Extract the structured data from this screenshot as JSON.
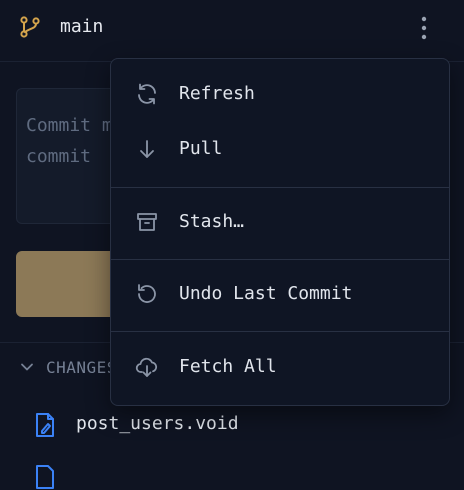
{
  "header": {
    "branch": "main"
  },
  "commit": {
    "placeholder": "Commit message\ncommit"
  },
  "changes": {
    "label": "CHANGES"
  },
  "files": [
    {
      "name": "post_users.void"
    }
  ],
  "menu": {
    "items": [
      {
        "label": "Refresh",
        "icon": "refresh-icon"
      },
      {
        "label": "Pull",
        "icon": "arrow-down-icon"
      },
      {
        "label": "Stash…",
        "icon": "archive-icon"
      },
      {
        "label": "Undo Last Commit",
        "icon": "undo-icon"
      },
      {
        "label": "Fetch All",
        "icon": "cloud-download-icon"
      }
    ]
  },
  "colors": {
    "accent": "#d4a44c",
    "button": "#8c7957",
    "fileIcon": "#3b82f6"
  }
}
